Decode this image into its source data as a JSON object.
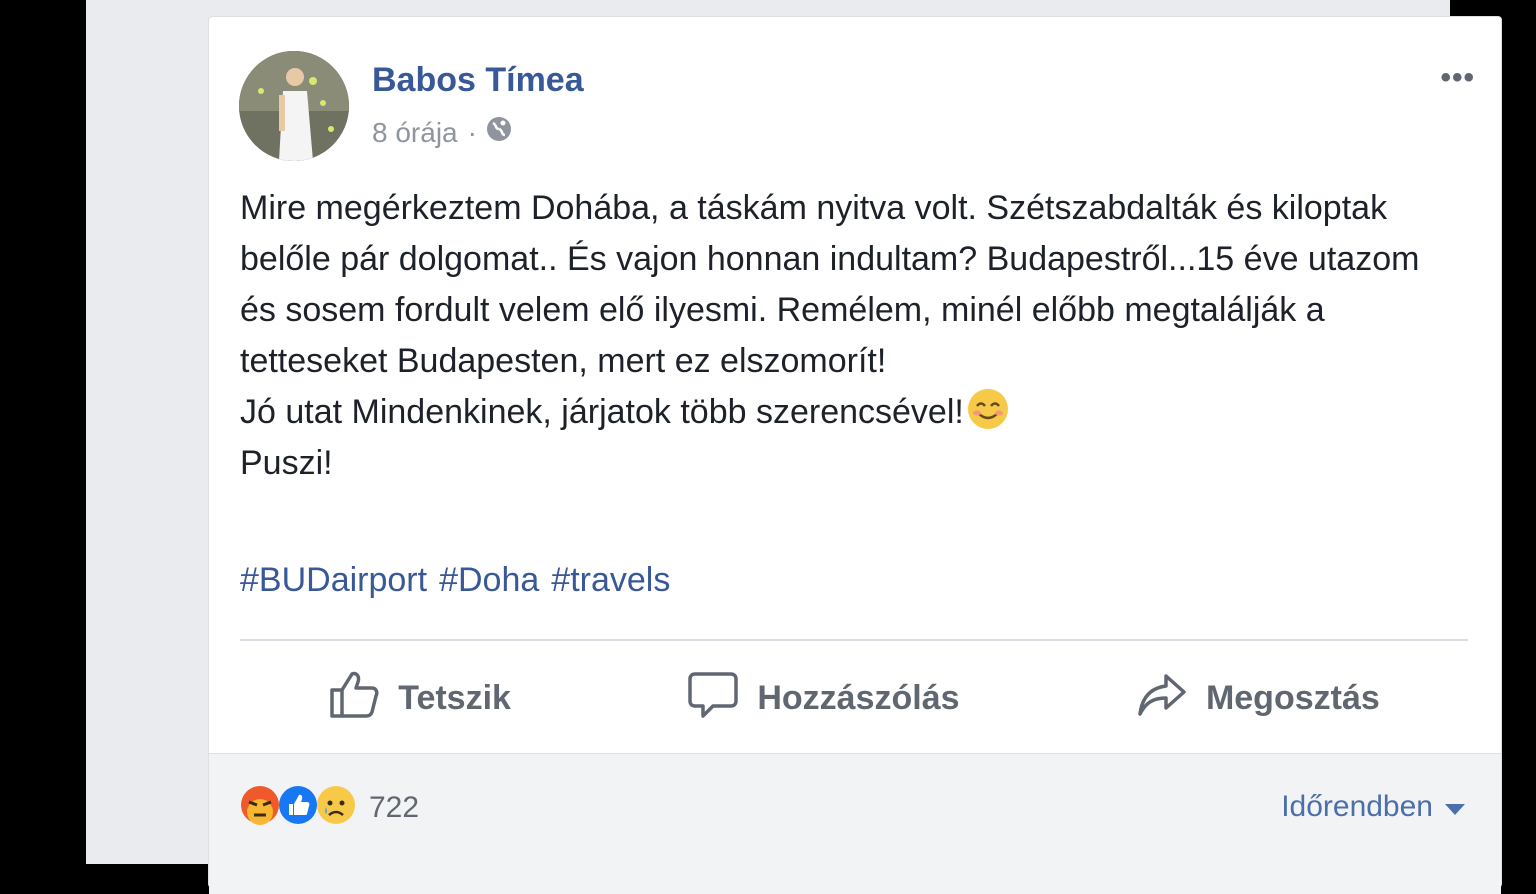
{
  "post": {
    "author": "Babos Tímea",
    "time": "8 órája",
    "separator": "·",
    "lines": [
      "Mire megérkeztem Dohába, a táskám nyitva volt. Szétszabdalták és kiloptak belőle pár dolgomat.. És vajon honnan indultam? Budapestről...15 éve utazom és sosem fordult velem elő ilyesmi. Remélem, minél előbb megtalálják a tetteseket Budapesten, mert ez elszomorít!",
      "Jó utat Mindenkinek, járjatok több szerencsével!",
      "Puszi!"
    ],
    "hashtags": [
      "#BUDairport",
      "#Doha",
      "#travels"
    ],
    "more": "•••"
  },
  "actions": {
    "like": "Tetszik",
    "comment": "Hozzászólás",
    "share": "Megosztás"
  },
  "footer": {
    "reaction_count": "722",
    "sort_label": "Időrendben"
  },
  "colors": {
    "link": "#385898",
    "text": "#1d2129",
    "muted": "#606770"
  },
  "icons": {
    "audience": "globe-icon",
    "like": "thumbs-up-icon",
    "comment": "speech-bubble-icon",
    "share": "share-arrow-icon",
    "reactions": [
      "angry-reaction-icon",
      "like-reaction-icon",
      "sad-reaction-icon"
    ],
    "emoji": "smiling-face-emoji"
  }
}
